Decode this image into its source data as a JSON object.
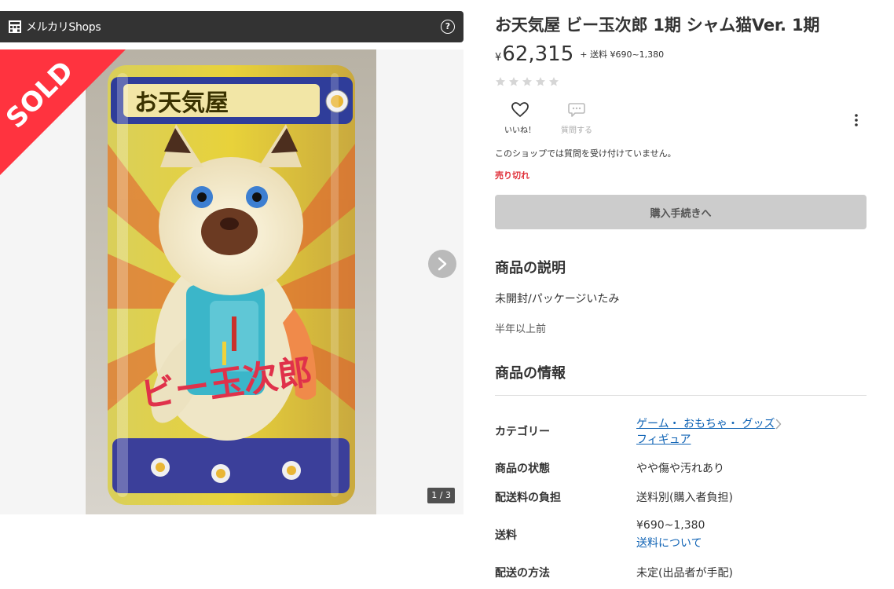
{
  "shop_bar": {
    "name": "メルカリShops",
    "help_glyph": "?"
  },
  "gallery": {
    "sold_label": "SOLD",
    "box_header_text": "お天気屋",
    "figure_label_text": "ビー玉次郎",
    "page_indicator": "1 / 3"
  },
  "product": {
    "title": "お天気屋 ビー玉次郎 1期 シャム猫Ver. 1期",
    "price_currency": "¥",
    "price": "62,315",
    "shipping_note": "+ 送料 ¥690~1,380",
    "rating_stars": 0,
    "like_label": "いいね！",
    "ask_label": "質問する",
    "no_questions_note": "このショップでは質問を受け付けていません。",
    "status": "売り切れ",
    "purchase_button": "購入手続きへ"
  },
  "description": {
    "heading": "商品の説明",
    "text": "未開封/パッケージいたみ",
    "posted": "半年以上前"
  },
  "info": {
    "heading": "商品の情報",
    "category_label": "カテゴリー",
    "category_path_1": "ゲーム・ おもちゃ・ グッズ",
    "category_path_2": "フィギュア",
    "condition_label": "商品の状態",
    "condition_value": "やや傷や汚れあり",
    "shipping_payer_label": "配送料の負担",
    "shipping_payer_value": "送料別(購入者負担)",
    "shipping_fee_label": "送料",
    "shipping_fee_value": "¥690~1,380",
    "shipping_fee_link": "送料について",
    "shipping_method_label": "配送の方法",
    "shipping_method_value": "未定(出品者が手配)"
  },
  "colors": {
    "shop_bar": "#333333",
    "sold_ribbon": "#ff333f",
    "sold_status": "#e0313a",
    "link": "#0f63b5",
    "disabled_button": "#cccccc"
  },
  "icons": {
    "shop_logo": "shop-logo-icon",
    "help": "help-icon",
    "next": "chevron-right-icon",
    "like": "heart-icon",
    "ask": "chat-bubble-icon",
    "more": "more-vertical-icon",
    "category_chevron": "chevron-right-icon"
  }
}
